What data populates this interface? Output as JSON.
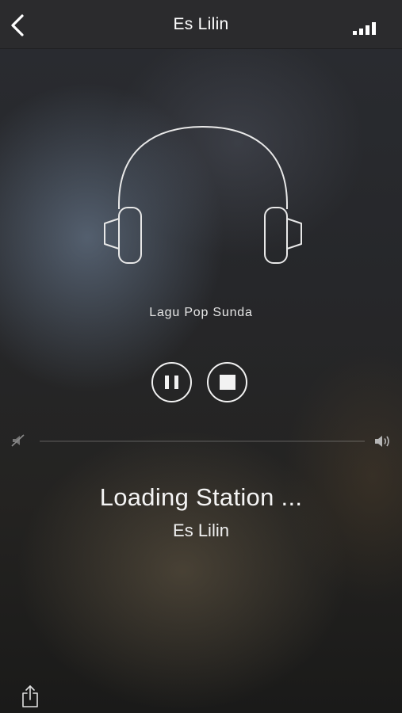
{
  "header": {
    "title": "Es Lilin",
    "back_icon": "chevron-left-icon",
    "signal_icon": "signal-bars-icon"
  },
  "player": {
    "genre": "Lagu Pop Sunda",
    "artwork_icon": "headphones-icon",
    "pause_icon": "pause-icon",
    "stop_icon": "stop-icon",
    "volume_level": 0,
    "volume_low_icon": "volume-mute-icon",
    "volume_high_icon": "volume-high-icon",
    "status": "Loading Station ...",
    "station_name": "Es Lilin"
  },
  "footer": {
    "share_icon": "share-icon"
  }
}
